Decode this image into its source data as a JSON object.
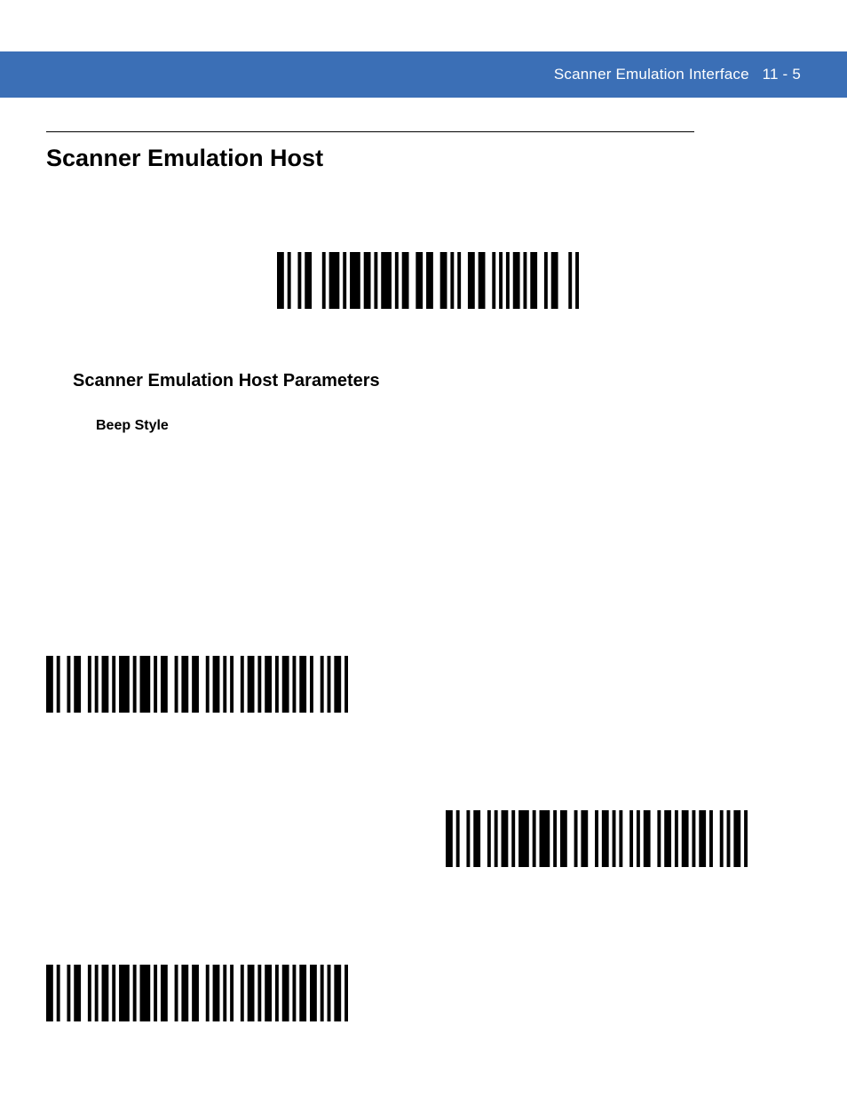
{
  "header": {
    "breadcrumb": "Scanner Emulation Interface",
    "page": "11 - 5"
  },
  "title": "Scanner Emulation Host",
  "subtitle": "Scanner Emulation Host Parameters",
  "sub2": "Beep Style",
  "barcodes": {
    "host": "110100101100010111010111011010111010110011011001101010011011001010101101011001011000101",
    "left1": "110100101100101011010111010111010110010110110010110101001011010110101101011010010101101",
    "right": "110100101100101011010111010111010110010110010110101001010110010110101101011010010101101",
    "left2": "110100101100101011010111010111010110010110110010110101001011010110101101011011010101101"
  }
}
